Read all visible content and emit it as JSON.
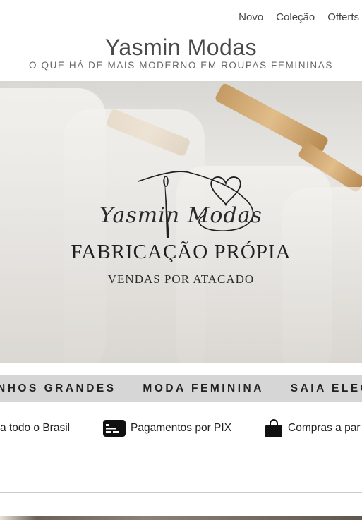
{
  "nav": {
    "items": [
      "Novo",
      "Coleção",
      "Offerts"
    ]
  },
  "brand": {
    "title": "Yasmin Modas",
    "subtitle": "O QUE HÁ DE MAIS MODERNO EM ROUPAS FEMININAS"
  },
  "hero": {
    "logo_script": "Yasmin Modas",
    "logo_main": "FABRICAÇÃO PRÓPIA",
    "logo_sub": "VENDAS POR ATACADO"
  },
  "marquee": {
    "items": [
      "NHOS GRANDES",
      "MODA FEMININA",
      "SAIA ELEGAN"
    ]
  },
  "features": {
    "shipping": "a todo o Brasil",
    "pix": "Pagamentos por PIX",
    "purchase": "Compras a par"
  }
}
